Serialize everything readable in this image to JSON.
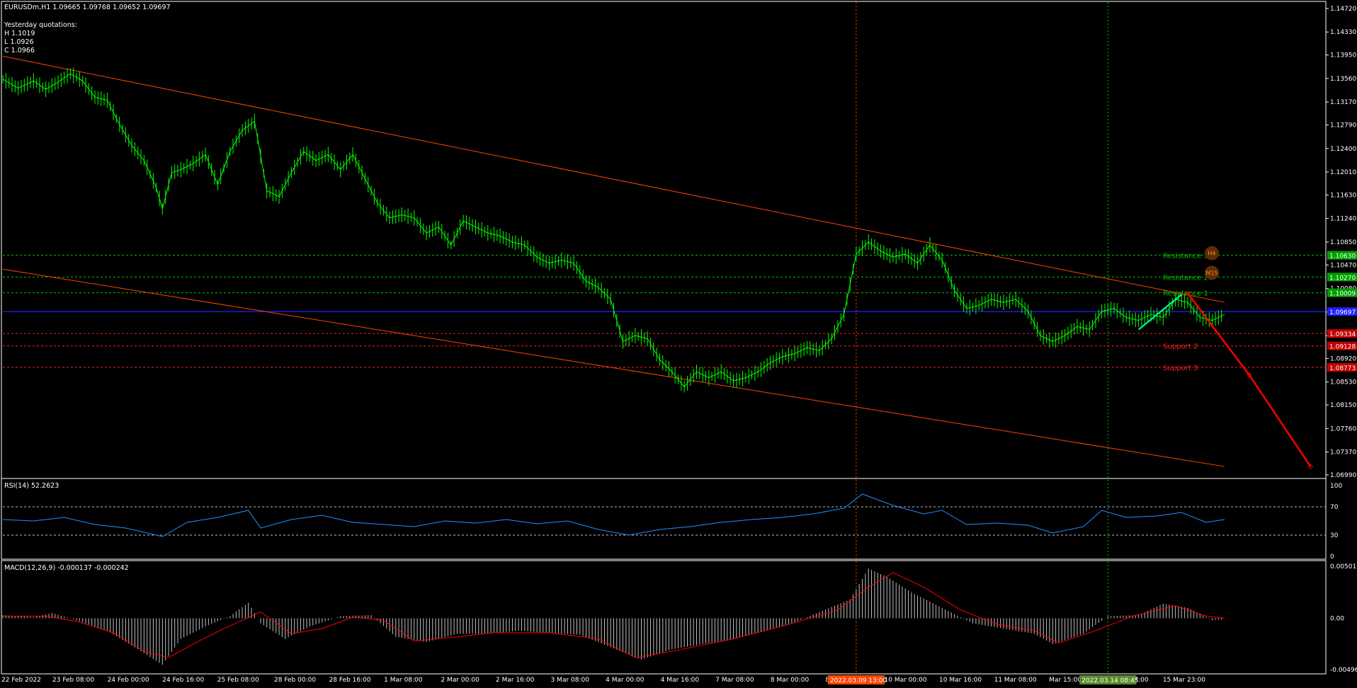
{
  "header": {
    "symbol_line": "EURUSDm,H1  1.09665 1.09768 1.09652 1.09697",
    "yq_title": "Yesterday quotations:",
    "yq_high": "H 1.1019",
    "yq_low": "L 1.0926",
    "yq_close": "C 1.0966"
  },
  "colors": {
    "background": "#000000",
    "candle": "#00ff00",
    "channel": "#ff4500",
    "resistance": "#00c000",
    "support": "#ff2020",
    "current_price": "#2020ff",
    "rsi_line": "#1e90ff",
    "macd_hist": "#c0c0c0",
    "macd_signal": "#ff0000",
    "forecast": "#ff0000",
    "rally": "#00ffa0"
  },
  "chart_data": [
    {
      "type": "line",
      "panel": "price",
      "instrument": "EURUSDm",
      "timeframe": "H1",
      "ohlc_last": {
        "open": 1.09665,
        "high": 1.09768,
        "low": 1.09652,
        "close": 1.09697
      },
      "y_ticks": [
        "1.14720",
        "1.14330",
        "1.13950",
        "1.13560",
        "1.13170",
        "1.12790",
        "1.12400",
        "1.12010",
        "1.11630",
        "1.11240",
        "1.10850",
        "1.10470",
        "1.10080",
        "1.09690",
        "1.09300",
        "1.08920",
        "1.08530",
        "1.08150",
        "1.07760",
        "1.07370",
        "1.06990"
      ],
      "ylim": [
        1.0699,
        1.1472
      ],
      "x_ticks": [
        "22 Feb 2022",
        "23 Feb 08:00",
        "24 Feb 00:00",
        "24 Feb 16:00",
        "25 Feb 08:00",
        "28 Feb 00:00",
        "28 Feb 16:00",
        "1 Mar 08:00",
        "2 Mar 00:00",
        "2 Mar 16:00",
        "3 Mar 08:00",
        "4 Mar 00:00",
        "4 Mar 16:00",
        "7 Mar 08:00",
        "8 Mar 00:00",
        "8 Mar 16:00",
        "10 Mar 00:00",
        "10 Mar 16:00",
        "11 Mar 08:00",
        "Mar 15:00",
        "15 Mar 07:00",
        "15 Mar 23:00"
      ],
      "vline_labels": [
        "2022.03.09 13:00",
        "2022.03.14 08:45"
      ],
      "price_series": [
        [
          0,
          1.1355
        ],
        [
          5,
          1.134
        ],
        [
          10,
          1.1352
        ],
        [
          14,
          1.1338
        ],
        [
          18,
          1.135
        ],
        [
          22,
          1.1364
        ],
        [
          26,
          1.1352
        ],
        [
          30,
          1.1325
        ],
        [
          34,
          1.132
        ],
        [
          38,
          1.128
        ],
        [
          42,
          1.1245
        ],
        [
          46,
          1.122
        ],
        [
          50,
          1.1175
        ],
        [
          52,
          1.114
        ],
        [
          55,
          1.12
        ],
        [
          58,
          1.1205
        ],
        [
          62,
          1.1215
        ],
        [
          66,
          1.123
        ],
        [
          70,
          1.118
        ],
        [
          74,
          1.1235
        ],
        [
          78,
          1.127
        ],
        [
          82,
          1.1285
        ],
        [
          86,
          1.117
        ],
        [
          90,
          1.116
        ],
        [
          94,
          1.12
        ],
        [
          98,
          1.1235
        ],
        [
          102,
          1.122
        ],
        [
          106,
          1.123
        ],
        [
          110,
          1.1205
        ],
        [
          114,
          1.123
        ],
        [
          118,
          1.119
        ],
        [
          122,
          1.115
        ],
        [
          126,
          1.1125
        ],
        [
          130,
          1.113
        ],
        [
          134,
          1.1125
        ],
        [
          138,
          1.11
        ],
        [
          142,
          1.111
        ],
        [
          146,
          1.108
        ],
        [
          150,
          1.112
        ],
        [
          154,
          1.111
        ],
        [
          158,
          1.11
        ],
        [
          162,
          1.1095
        ],
        [
          166,
          1.1085
        ],
        [
          170,
          1.108
        ],
        [
          174,
          1.106
        ],
        [
          178,
          1.105
        ],
        [
          182,
          1.1055
        ],
        [
          186,
          1.105
        ],
        [
          190,
          1.102
        ],
        [
          194,
          1.101
        ],
        [
          198,
          1.099
        ],
        [
          202,
          1.092
        ],
        [
          206,
          1.093
        ],
        [
          210,
          1.0925
        ],
        [
          214,
          1.089
        ],
        [
          218,
          1.087
        ],
        [
          222,
          1.0845
        ],
        [
          226,
          1.087
        ],
        [
          230,
          1.086
        ],
        [
          234,
          1.087
        ],
        [
          238,
          1.0855
        ],
        [
          242,
          1.086
        ],
        [
          246,
          1.087
        ],
        [
          250,
          1.0885
        ],
        [
          254,
          1.0895
        ],
        [
          258,
          1.09
        ],
        [
          262,
          1.091
        ],
        [
          266,
          1.0905
        ],
        [
          270,
          1.0925
        ],
        [
          274,
          1.0965
        ],
        [
          278,
          1.1065
        ],
        [
          282,
          1.1085
        ],
        [
          286,
          1.107
        ],
        [
          290,
          1.106
        ],
        [
          294,
          1.1065
        ],
        [
          298,
          1.105
        ],
        [
          302,
          1.108
        ],
        [
          306,
          1.1055
        ],
        [
          310,
          1.1005
        ],
        [
          314,
          1.0975
        ],
        [
          318,
          1.098
        ],
        [
          322,
          1.099
        ],
        [
          326,
          1.0985
        ],
        [
          330,
          1.099
        ],
        [
          334,
          1.097
        ],
        [
          338,
          1.093
        ],
        [
          342,
          1.092
        ],
        [
          346,
          1.093
        ],
        [
          350,
          1.0945
        ],
        [
          354,
          1.094
        ],
        [
          358,
          1.097
        ],
        [
          362,
          1.0975
        ],
        [
          366,
          1.096
        ],
        [
          370,
          1.0955
        ],
        [
          374,
          1.0965
        ],
        [
          378,
          1.096
        ],
        [
          382,
          1.099
        ],
        [
          386,
          1.0985
        ],
        [
          390,
          1.096
        ],
        [
          394,
          1.0955
        ],
        [
          398,
          1.0965
        ]
      ],
      "levels": [
        {
          "name": "Resistance 3",
          "value": 1.1063
        },
        {
          "name": "Resistance 2",
          "value": 1.1027
        },
        {
          "name": "Resistance 1",
          "value": 1.10009
        },
        {
          "name": "Support 2",
          "value": 1.09128
        },
        {
          "name": "Support 3",
          "value": 1.08773
        }
      ],
      "level_labels": [
        "1.10630",
        "1.10270",
        "1.10009",
        "1.09697",
        "1.09334",
        "1.09128",
        "1.08773"
      ],
      "badges": [
        "H4",
        "M15"
      ],
      "channel_upper": [
        [
          0,
          1.1393
        ],
        [
          398,
          1.0985
        ]
      ],
      "channel_lower": [
        [
          0,
          1.104
        ],
        [
          398,
          1.0713
        ]
      ],
      "forecast_path": [
        [
          386,
          1.1
        ],
        [
          406,
          1.0865
        ],
        [
          426,
          1.0713
        ]
      ]
    },
    {
      "type": "line",
      "panel": "rsi",
      "title": "RSI(14) 52.2623",
      "ylim": [
        0,
        100
      ],
      "levels": [
        30,
        70
      ],
      "y_ticks": [
        "100",
        "70",
        "30",
        "0"
      ],
      "series": [
        [
          0,
          52
        ],
        [
          10,
          50
        ],
        [
          20,
          55
        ],
        [
          30,
          45
        ],
        [
          40,
          40
        ],
        [
          52,
          28
        ],
        [
          60,
          48
        ],
        [
          70,
          55
        ],
        [
          80,
          65
        ],
        [
          84,
          40
        ],
        [
          94,
          52
        ],
        [
          104,
          58
        ],
        [
          114,
          48
        ],
        [
          124,
          45
        ],
        [
          134,
          42
        ],
        [
          144,
          50
        ],
        [
          154,
          47
        ],
        [
          164,
          52
        ],
        [
          174,
          46
        ],
        [
          184,
          50
        ],
        [
          194,
          38
        ],
        [
          204,
          30
        ],
        [
          214,
          38
        ],
        [
          224,
          42
        ],
        [
          234,
          48
        ],
        [
          244,
          52
        ],
        [
          254,
          55
        ],
        [
          264,
          60
        ],
        [
          274,
          68
        ],
        [
          280,
          88
        ],
        [
          290,
          72
        ],
        [
          300,
          60
        ],
        [
          306,
          65
        ],
        [
          314,
          45
        ],
        [
          324,
          47
        ],
        [
          334,
          44
        ],
        [
          342,
          33
        ],
        [
          352,
          42
        ],
        [
          358,
          65
        ],
        [
          366,
          55
        ],
        [
          376,
          57
        ],
        [
          384,
          62
        ],
        [
          392,
          48
        ],
        [
          398,
          52
        ]
      ]
    },
    {
      "type": "bar",
      "panel": "macd",
      "title": "MACD(12,26,9) -0.000137 -0.000242",
      "ylim": [
        -0.004965,
        0.005019
      ],
      "y_ticks": [
        "0.005019",
        "0.00",
        "-0.004965"
      ],
      "histogram": [
        [
          0,
          0.0003
        ],
        [
          10,
          0.0001
        ],
        [
          16,
          0.0005
        ],
        [
          24,
          -0.0002
        ],
        [
          34,
          -0.0012
        ],
        [
          44,
          -0.003
        ],
        [
          52,
          -0.0045
        ],
        [
          58,
          -0.002
        ],
        [
          66,
          -0.0008
        ],
        [
          74,
          0.0002
        ],
        [
          80,
          0.0015
        ],
        [
          84,
          -0.0005
        ],
        [
          92,
          -0.002
        ],
        [
          100,
          -0.0008
        ],
        [
          110,
          0.0002
        ],
        [
          120,
          0.0003
        ],
        [
          128,
          -0.0018
        ],
        [
          138,
          -0.0023
        ],
        [
          148,
          -0.0015
        ],
        [
          158,
          -0.0015
        ],
        [
          168,
          -0.0012
        ],
        [
          178,
          -0.0014
        ],
        [
          188,
          -0.0016
        ],
        [
          198,
          -0.0028
        ],
        [
          208,
          -0.004
        ],
        [
          218,
          -0.003
        ],
        [
          228,
          -0.0025
        ],
        [
          238,
          -0.002
        ],
        [
          248,
          -0.0012
        ],
        [
          258,
          -0.0004
        ],
        [
          266,
          0.0006
        ],
        [
          276,
          0.0018
        ],
        [
          282,
          0.0048
        ],
        [
          288,
          0.004
        ],
        [
          296,
          0.0025
        ],
        [
          306,
          0.001
        ],
        [
          316,
          -0.0005
        ],
        [
          326,
          -0.001
        ],
        [
          336,
          -0.0015
        ],
        [
          342,
          -0.0025
        ],
        [
          352,
          -0.0015
        ],
        [
          360,
          0.0002
        ],
        [
          370,
          0.0003
        ],
        [
          378,
          0.0014
        ],
        [
          386,
          0.001
        ],
        [
          394,
          -0.0002
        ],
        [
          398,
          -0.0001
        ]
      ],
      "signal": [
        [
          0,
          0.0002
        ],
        [
          14,
          0.0002
        ],
        [
          24,
          -0.0003
        ],
        [
          36,
          -0.0014
        ],
        [
          46,
          -0.0032
        ],
        [
          54,
          -0.0038
        ],
        [
          62,
          -0.0025
        ],
        [
          72,
          -0.001
        ],
        [
          84,
          0.0006
        ],
        [
          94,
          -0.0015
        ],
        [
          104,
          -0.001
        ],
        [
          114,
          0.0001
        ],
        [
          124,
          -0.0002
        ],
        [
          134,
          -0.0022
        ],
        [
          148,
          -0.0018
        ],
        [
          160,
          -0.0014
        ],
        [
          178,
          -0.0014
        ],
        [
          194,
          -0.002
        ],
        [
          206,
          -0.0038
        ],
        [
          218,
          -0.0032
        ],
        [
          238,
          -0.002
        ],
        [
          256,
          -0.0006
        ],
        [
          272,
          0.0008
        ],
        [
          282,
          0.003
        ],
        [
          290,
          0.0044
        ],
        [
          300,
          0.003
        ],
        [
          312,
          0.0008
        ],
        [
          324,
          -0.0006
        ],
        [
          336,
          -0.0012
        ],
        [
          344,
          -0.0024
        ],
        [
          356,
          -0.0012
        ],
        [
          368,
          0.0002
        ],
        [
          382,
          0.0012
        ],
        [
          392,
          0.0002
        ],
        [
          398,
          0.0
        ]
      ]
    }
  ]
}
